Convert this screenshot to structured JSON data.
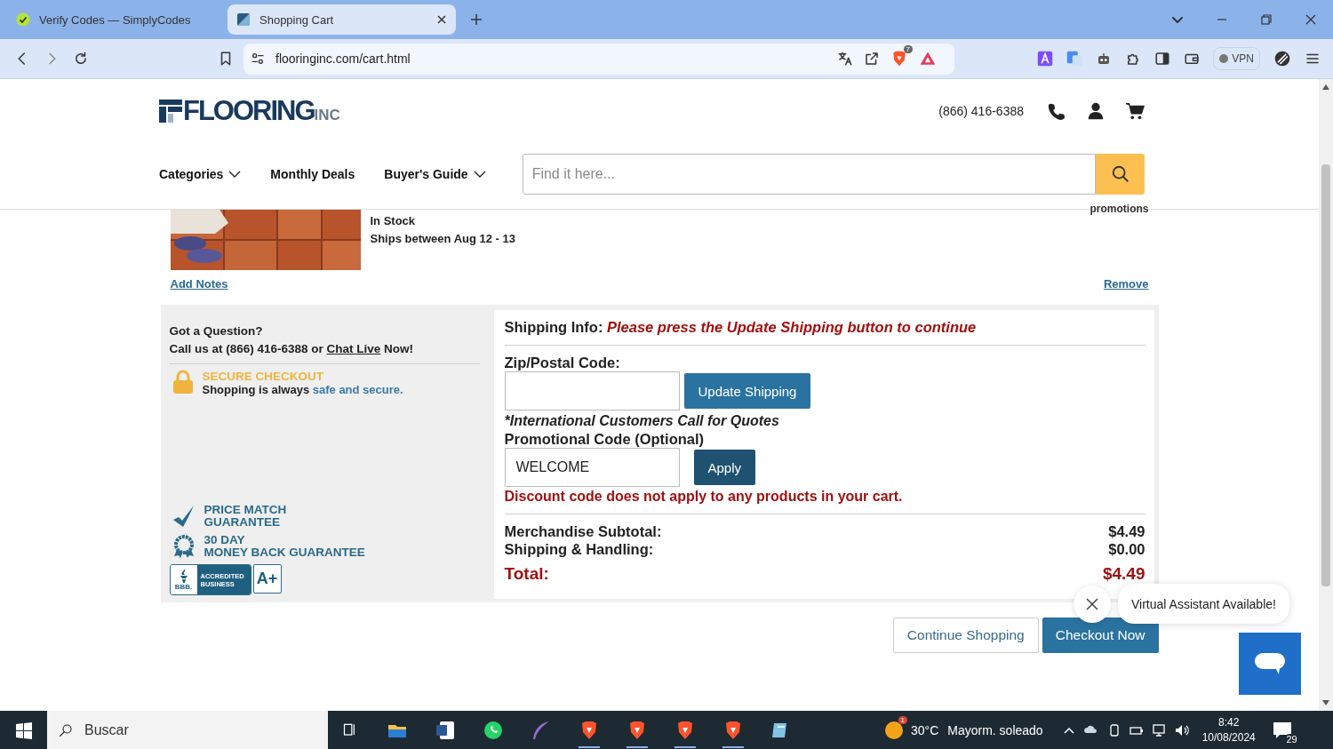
{
  "browser": {
    "tabs": [
      {
        "title": "Verify Codes — SimplyCodes",
        "selected": false
      },
      {
        "title": "Shopping Cart",
        "selected": true
      }
    ],
    "address": "flooringinc.com/cart.html",
    "shields_count": "7",
    "vpn": "VPN"
  },
  "header": {
    "logo": "FLOORING",
    "logo_suffix": "INC",
    "phone": "(866) 416-6388",
    "nav": [
      {
        "label": "Categories",
        "has_menu": true
      },
      {
        "label": "Monthly Deals",
        "has_menu": false
      },
      {
        "label": "Buyer's Guide",
        "has_menu": true
      }
    ],
    "search": {
      "placeholder": "Find it here..."
    }
  },
  "cart_item": {
    "stock": "In Stock",
    "shipping": "Ships between Aug 12 - 13",
    "promotions_note": "promotions",
    "add_notes": "Add Notes",
    "remove": "Remove"
  },
  "help": {
    "question": "Got a Question?",
    "contact_before": "Call us at (866) 416-6388 or ",
    "chat_link": "Chat Live",
    "contact_after": " Now!"
  },
  "secure": {
    "title": "SECURE CHECKOUT",
    "text": "Shopping is always ",
    "highlight": "safe and secure."
  },
  "guarantees": [
    {
      "kind": "price_match",
      "lines": [
        "PRICE MATCH",
        "GUARANTEE"
      ]
    },
    {
      "kind": "money_back",
      "lines": [
        "30 DAY",
        "MONEY BACK GUARANTEE"
      ]
    }
  ],
  "bbb": {
    "mark": "BBB.",
    "label": [
      "ACCREDITED",
      "BUSINESS"
    ],
    "rating": "A+"
  },
  "shipping": {
    "label": "Shipping Info:",
    "message": "Please press the Update Shipping button to continue",
    "zip_label": "Zip/Postal Code:",
    "update_button": "Update Shipping",
    "intl_note": "*International Customers Call for Quotes",
    "promo_label": "Promotional Code (Optional)",
    "promo_value": "WELCOME",
    "apply_button": "Apply",
    "promo_error": "Discount code does not apply to any products in your cart."
  },
  "totals": [
    {
      "kind": "line",
      "label": "Merchandise Subtotal:",
      "value": "$4.49"
    },
    {
      "kind": "line",
      "label": "Shipping & Handling:",
      "value": "$0.00"
    },
    {
      "kind": "total",
      "label": "Total:",
      "value": "$4.49"
    }
  ],
  "actions": [
    {
      "kind": "secondary",
      "label": "Continue Shopping"
    },
    {
      "kind": "primary",
      "label": "Checkout Now"
    }
  ],
  "assistant": {
    "message": "Virtual Assistant Available!"
  },
  "taskbar": {
    "search_placeholder": "Buscar",
    "weather": {
      "temp": "30°C",
      "text": "Mayorm. soleado",
      "alert": "1"
    },
    "time": "8:42",
    "date": "10/08/2024",
    "notifications": "29"
  }
}
